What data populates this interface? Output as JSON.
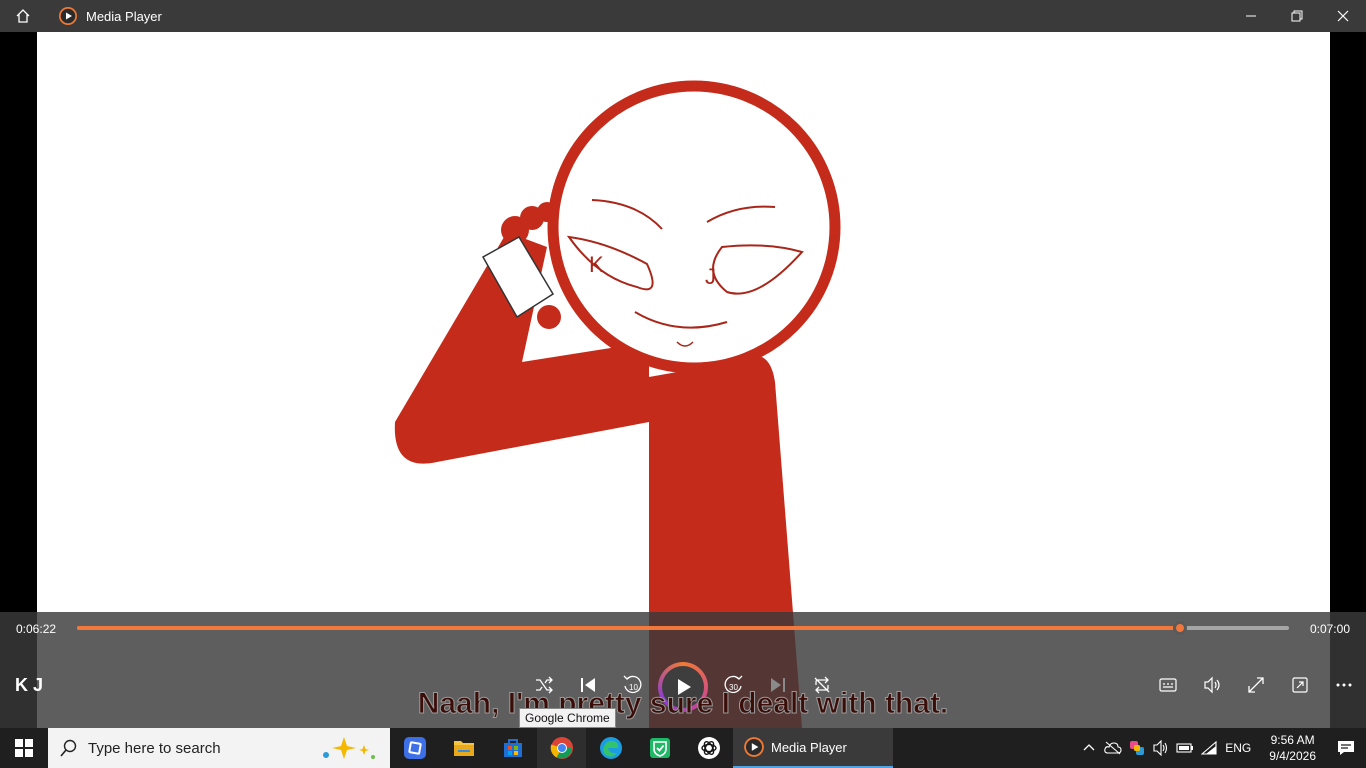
{
  "window": {
    "app_title": "Media Player",
    "icons": {
      "home": "home-icon",
      "app": "media-player-icon",
      "minimize": "minimize-icon",
      "restore": "restore-icon",
      "close": "close-icon"
    }
  },
  "video": {
    "letters": [
      "K",
      "J"
    ]
  },
  "player": {
    "current_time": "0:06:22",
    "total_time": "0:07:00",
    "progress_fraction": 0.91,
    "media_title": "K J",
    "subtitle": "Naah, I'm pretty sure I dealt with that.",
    "accent_color": "#f0783c",
    "buttons": [
      "shuffle-icon",
      "previous-icon",
      "rewind-10-icon",
      "play-icon",
      "forward-30-icon",
      "next-icon",
      "repeat-icon",
      "captions-icon",
      "volume-icon",
      "fullscreen-icon",
      "mini-player-icon",
      "more-icon"
    ],
    "rewind_label": "10",
    "forward_label": "30"
  },
  "tooltip": {
    "text": "Google Chrome"
  },
  "taskbar": {
    "search_placeholder": "Type here to search",
    "apps": [
      "app-store-blue-icon",
      "file-explorer-icon",
      "microsoft-store-icon",
      "chrome-icon",
      "edge-icon",
      "security-check-icon",
      "chatgpt-icon"
    ],
    "running_app_label": "Media Player",
    "language": "ENG",
    "time": "9:56 AM",
    "date": "9/4/2026"
  }
}
